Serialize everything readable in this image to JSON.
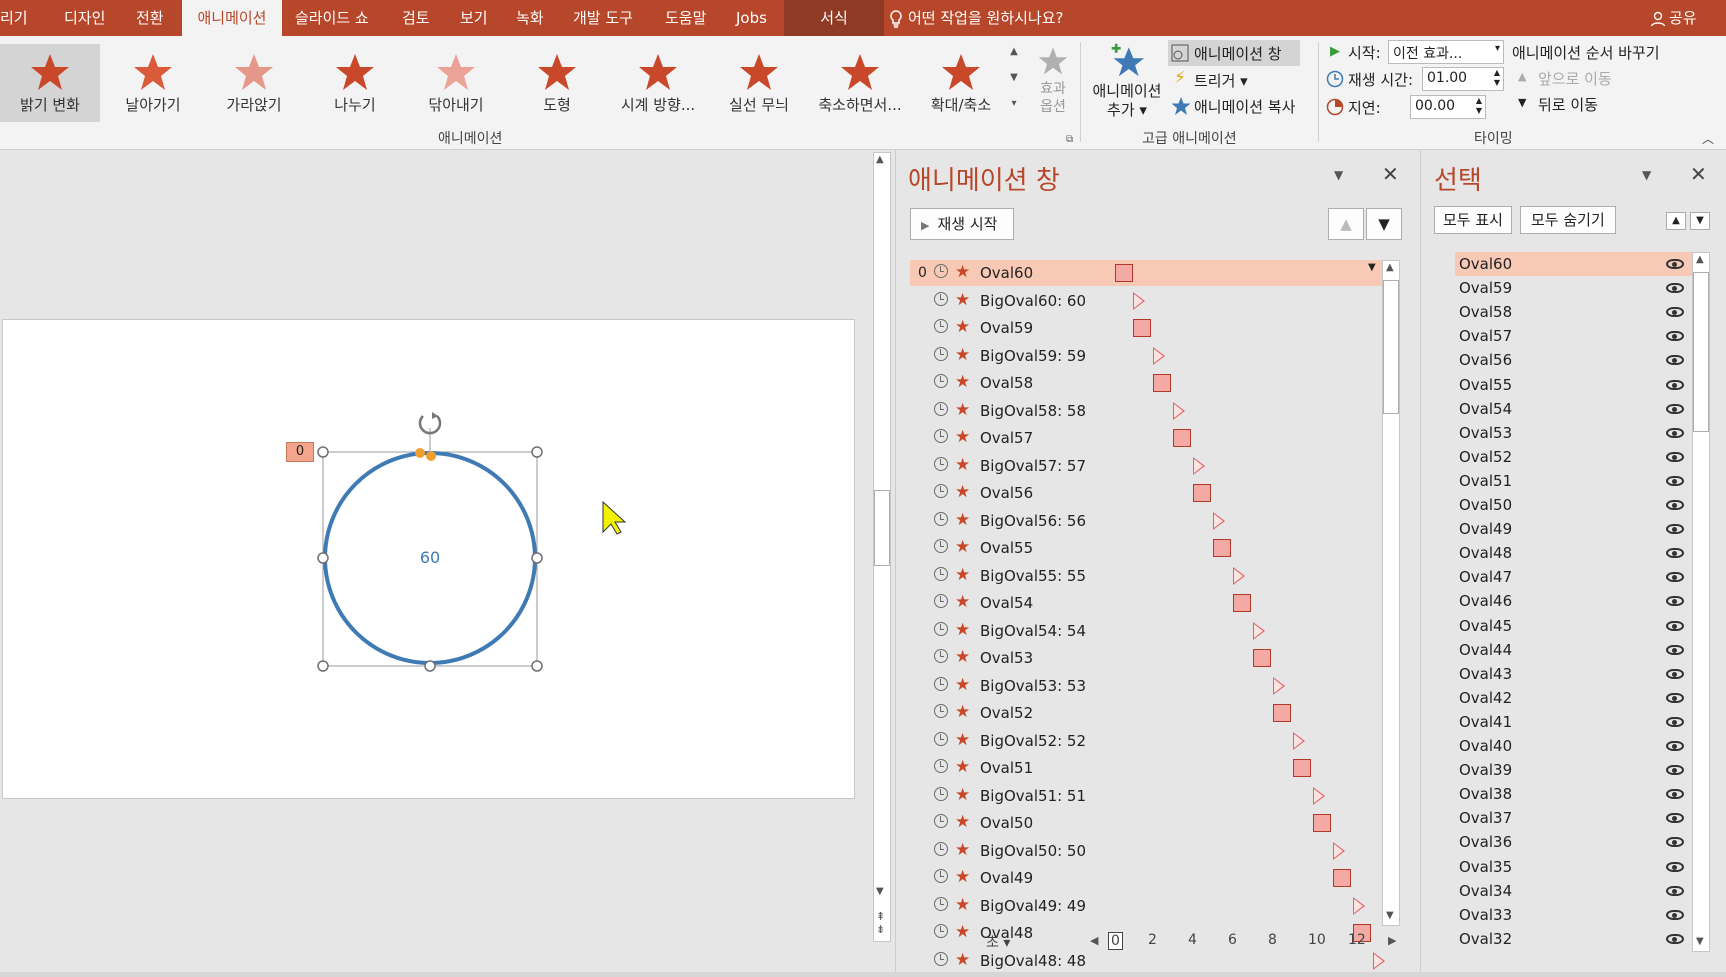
{
  "menu": {
    "tabs": [
      "리기",
      "디자인",
      "전환",
      "애니메이션",
      "슬라이드 쇼",
      "검토",
      "보기",
      "녹화",
      "개발 도구",
      "도움말",
      "Jobs",
      "서식"
    ],
    "active_tab": "애니메이션",
    "tell_me": "어떤 작업을 원하시나요?",
    "share": "공유"
  },
  "ribbon": {
    "gallery": [
      "밝기 변화",
      "날아가기",
      "가라앉기",
      "나누기",
      "닦아내기",
      "도형",
      "시계 방향...",
      "실선 무늬",
      "축소하면서...",
      "확대/축소"
    ],
    "effect_options_1": "효과",
    "effect_options_2": "옵션",
    "animation_group": "애니메이션",
    "add_animation_1": "애니메이션",
    "add_animation_2": "추가",
    "animation_pane_btn": "애니메이션 창",
    "trigger_btn": "트리거",
    "painter_btn": "애니메이션 복사",
    "advanced_group": "고급 애니메이션",
    "start_label": "시작:",
    "start_value": "이전 효과...",
    "duration_label": "재생 시간:",
    "duration_value": "01.00",
    "delay_label": "지연:",
    "delay_value": "00.00",
    "reorder_title": "애니메이션 순서 바꾸기",
    "move_earlier": "앞으로 이동",
    "move_later": "뒤로 이동",
    "timing_group": "타이밍"
  },
  "slide": {
    "shape_text": "60",
    "tag": "0"
  },
  "anim_pane": {
    "title": "애니메이션 창",
    "play_button": "재생 시작",
    "first_num": "0",
    "rows": [
      "Oval60",
      "BigOval60: 60",
      "Oval59",
      "BigOval59: 59",
      "Oval58",
      "BigOval58: 58",
      "Oval57",
      "BigOval57: 57",
      "Oval56",
      "BigOval56: 56",
      "Oval55",
      "BigOval55: 55",
      "Oval54",
      "BigOval54: 54",
      "Oval53",
      "BigOval53: 53",
      "Oval52",
      "BigOval52: 52",
      "Oval51",
      "BigOval51: 51",
      "Oval50",
      "BigOval50: 50",
      "Oval49",
      "BigOval49: 49",
      "Oval48",
      "BigOval48: 48"
    ],
    "seconds_label": "초",
    "timeline_ticks": [
      "0",
      "2",
      "4",
      "6",
      "8",
      "10",
      "12"
    ]
  },
  "selection_pane": {
    "title": "선택",
    "show_all": "모두 표시",
    "hide_all": "모두 숨기기",
    "items": [
      "Oval60",
      "Oval59",
      "Oval58",
      "Oval57",
      "Oval56",
      "Oval55",
      "Oval54",
      "Oval53",
      "Oval52",
      "Oval51",
      "Oval50",
      "Oval49",
      "Oval48",
      "Oval47",
      "Oval46",
      "Oval45",
      "Oval44",
      "Oval43",
      "Oval42",
      "Oval41",
      "Oval40",
      "Oval39",
      "Oval38",
      "Oval37",
      "Oval36",
      "Oval35",
      "Oval34",
      "Oval33",
      "Oval32"
    ]
  },
  "colors": {
    "brand": "#b7472a",
    "selected_row": "#f8c9b4",
    "shape_stroke": "#3f7ab5"
  }
}
